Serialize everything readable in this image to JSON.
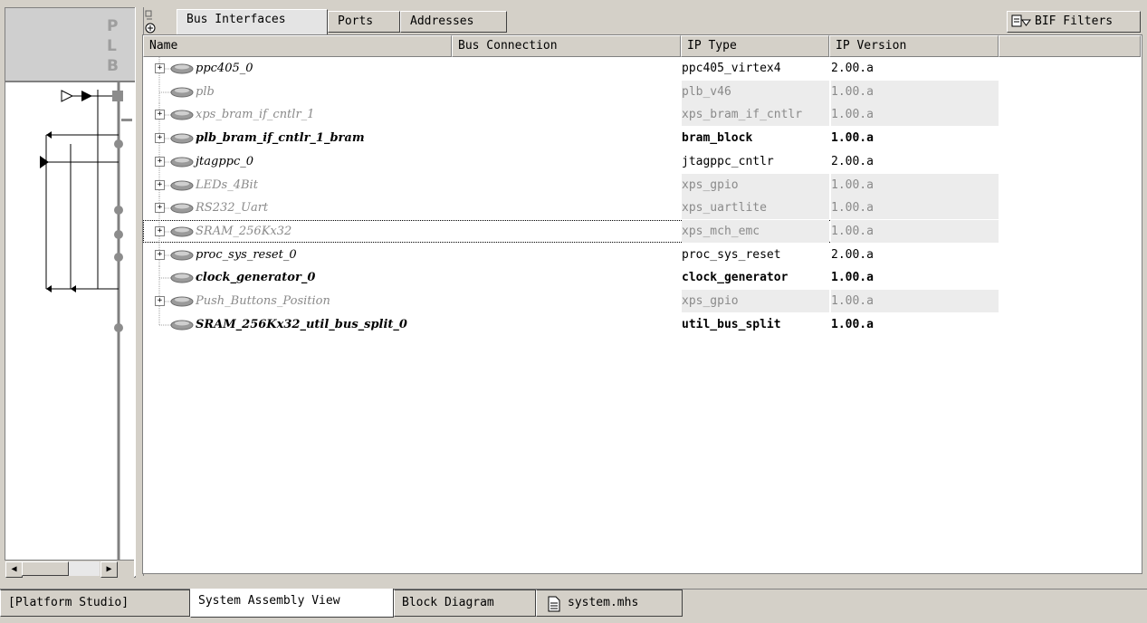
{
  "left_panel": {
    "header_letters": [
      "P",
      "L",
      "B"
    ]
  },
  "tabs": [
    "Bus Interfaces",
    "Ports",
    "Addresses"
  ],
  "bif_filters_label": "BIF Filters",
  "columns": [
    "Name",
    "Bus Connection",
    "IP Type",
    "IP Version"
  ],
  "rows": [
    {
      "name": "ppc405_0",
      "type": "ppc405_virtex4",
      "version": "2.00.a",
      "expand": true,
      "state": "normal"
    },
    {
      "name": "plb",
      "type": "plb_v46",
      "version": "1.00.a",
      "expand": false,
      "state": "dim"
    },
    {
      "name": "xps_bram_if_cntlr_1",
      "type": "xps_bram_if_cntlr",
      "version": "1.00.a",
      "expand": true,
      "state": "dim"
    },
    {
      "name": "plb_bram_if_cntlr_1_bram",
      "type": "bram_block",
      "version": "1.00.a",
      "expand": true,
      "state": "bold"
    },
    {
      "name": "jtagppc_0",
      "type": "jtagppc_cntlr",
      "version": "2.00.a",
      "expand": true,
      "state": "normal"
    },
    {
      "name": "LEDs_4Bit",
      "type": "xps_gpio",
      "version": "1.00.a",
      "expand": true,
      "state": "dim"
    },
    {
      "name": "RS232_Uart",
      "type": "xps_uartlite",
      "version": "1.00.a",
      "expand": true,
      "state": "dim"
    },
    {
      "name": "SRAM_256Kx32",
      "type": "xps_mch_emc",
      "version": "1.00.a",
      "expand": true,
      "state": "dim",
      "selected": true
    },
    {
      "name": "proc_sys_reset_0",
      "type": "proc_sys_reset",
      "version": "2.00.a",
      "expand": true,
      "state": "normal"
    },
    {
      "name": "clock_generator_0",
      "type": "clock_generator",
      "version": "1.00.a",
      "expand": false,
      "state": "bold"
    },
    {
      "name": "Push_Buttons_Position",
      "type": "xps_gpio",
      "version": "1.00.a",
      "expand": true,
      "state": "dim"
    },
    {
      "name": "SRAM_256Kx32_util_bus_split_0",
      "type": "util_bus_split",
      "version": "1.00.a",
      "expand": false,
      "state": "bold"
    }
  ],
  "bottom_tabs": [
    "[Platform Studio]",
    "System Assembly View",
    "Block Diagram",
    "system.mhs"
  ],
  "icons": {
    "instance": "gray-diamond-icon",
    "expand": "plus-box-icon",
    "filter": "filter-icon",
    "file": "document-icon",
    "panel_toggle": "panel-toggle-icon",
    "scroll_left": "arrow-left-icon",
    "scroll_right": "arrow-right-icon"
  },
  "colors": {
    "background": "#d4d0c8",
    "dim_text": "#8a8a8a",
    "row_shade": "#ececec"
  }
}
